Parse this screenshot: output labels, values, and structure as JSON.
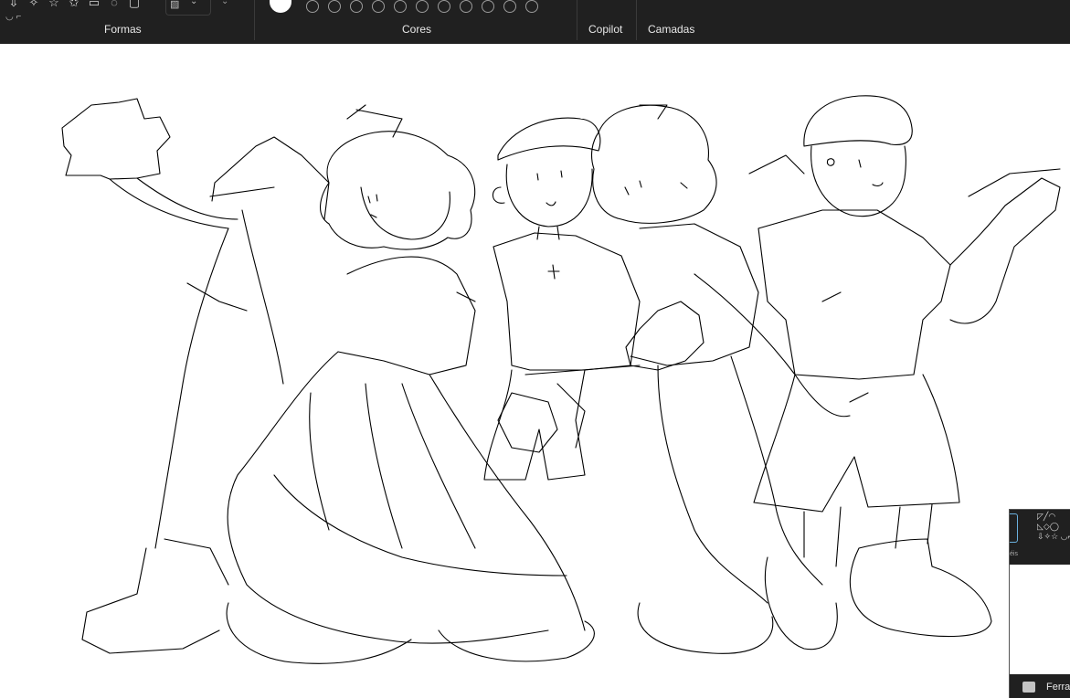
{
  "ribbon": {
    "groups": {
      "shapes": "Formas",
      "colors": "Cores",
      "copilot": "Copilot",
      "layers": "Camadas"
    },
    "shape_glyphs": [
      "⇩",
      "✧",
      "☆",
      "✩",
      "▭",
      "◌",
      "▢",
      "◯"
    ],
    "shape_row2": "◡ ⌐",
    "fill_icon": "▨",
    "chevron": "⌄",
    "primary_color": "#ffffff",
    "palette": [
      "#202020",
      "#202020",
      "#202020",
      "#202020",
      "#202020",
      "#202020",
      "#202020",
      "#202020",
      "#202020",
      "#202020",
      "#202020"
    ]
  },
  "mini_panel": {
    "shape_glyphs": "◸╱◠ ◺◇◯ ⇩✧☆ ◡⌐",
    "side_label": "éis",
    "bottom_label": "Ferra"
  }
}
